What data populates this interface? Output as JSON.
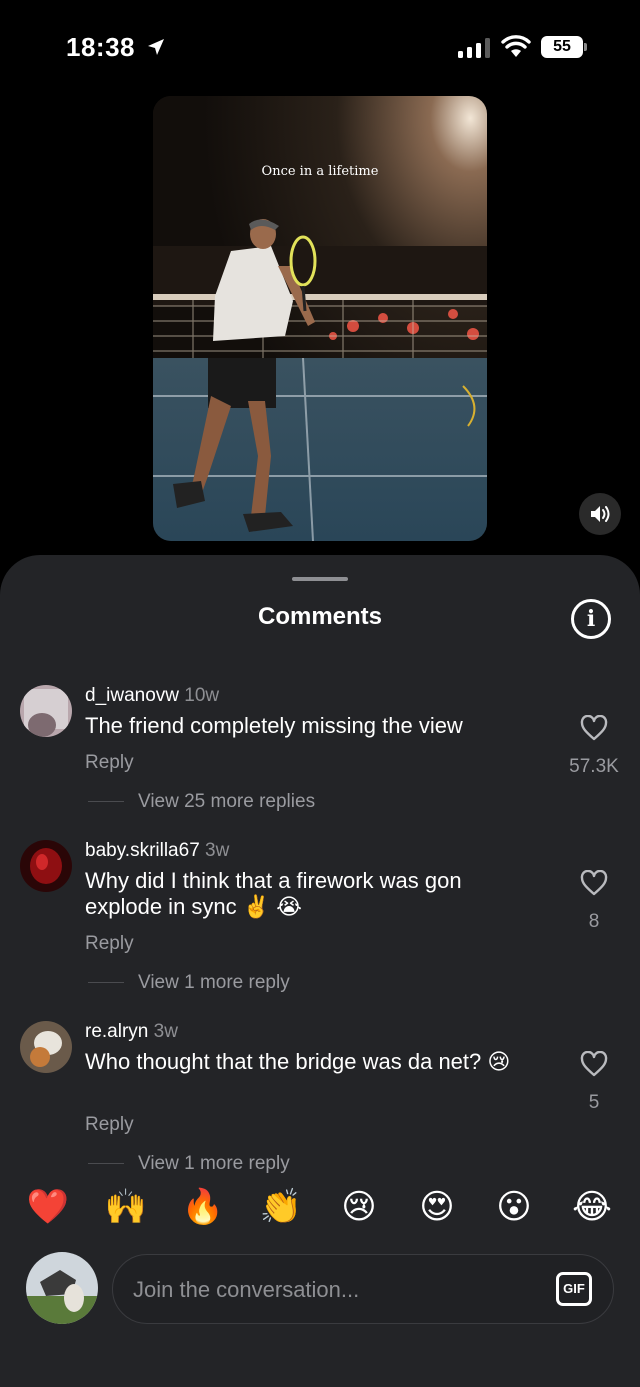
{
  "status_bar": {
    "time": "18:38",
    "battery": "55",
    "icons": [
      "location-arrow-icon",
      "cellular-signal-icon",
      "wifi-icon",
      "battery-icon"
    ]
  },
  "video": {
    "caption": "Once in a lifetime"
  },
  "sheet": {
    "title": "Comments"
  },
  "comments": [
    {
      "username": "d_iwanovw",
      "time": "10w",
      "text": "The friend completely missing the view",
      "reply_label": "Reply",
      "likes": "57.3K",
      "view_replies": "View 25 more replies"
    },
    {
      "username": "baby.skrilla67",
      "time": "3w",
      "text": "Why did I think that a firework was gon explode in sync ✌️ 😭",
      "reply_label": "Reply",
      "likes": "8",
      "view_replies": "View 1 more reply"
    },
    {
      "username": "re.alryn",
      "time": "3w",
      "text": "Who thought that the bridge was da net? 😢",
      "reply_label": "Reply",
      "likes": "5",
      "view_replies": "View 1 more reply"
    }
  ],
  "emoji_bar": [
    "❤️",
    "🙌",
    "🔥",
    "👏",
    "😢",
    "😍",
    "😮",
    "😂"
  ],
  "composer": {
    "placeholder": "Join the conversation...",
    "gif_label": "GIF"
  }
}
